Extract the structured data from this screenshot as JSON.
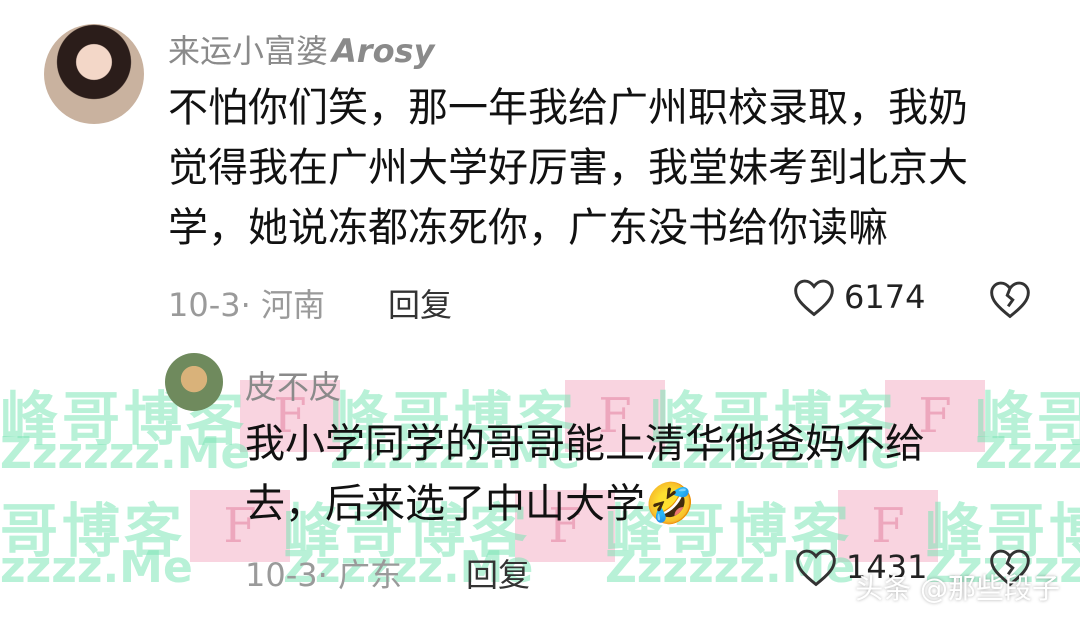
{
  "comments": [
    {
      "username": "来运小富婆",
      "username_en": "Arosy",
      "lines": [
        "不怕你们笑，那一年我给广州职校录取，我奶",
        "觉得我在广州大学好厉害，我堂妹考到北京大",
        "学，她说冻都冻死你，广东没书给你读嘛"
      ],
      "meta": "10-3· 河南",
      "reply_label": "回复",
      "likes": "6174"
    },
    {
      "username": "皮不皮",
      "lines": [
        "我小学同学的哥哥能上清华他爸妈不给",
        "去，后来选了中山大学"
      ],
      "emoji": "🤣",
      "meta": "10-3· 广东",
      "reply_label": "回复",
      "likes": "1431"
    }
  ],
  "watermark": {
    "blog": "峰哥博客",
    "blog_short": "哥博客",
    "site": "Zzzzzz.Me",
    "site_short": "zzzz.Me",
    "letter": "F"
  },
  "footer": {
    "brand": "头条 @那些段子"
  },
  "icons": {
    "heart": "heart-icon",
    "dislike": "broken-heart-icon"
  }
}
